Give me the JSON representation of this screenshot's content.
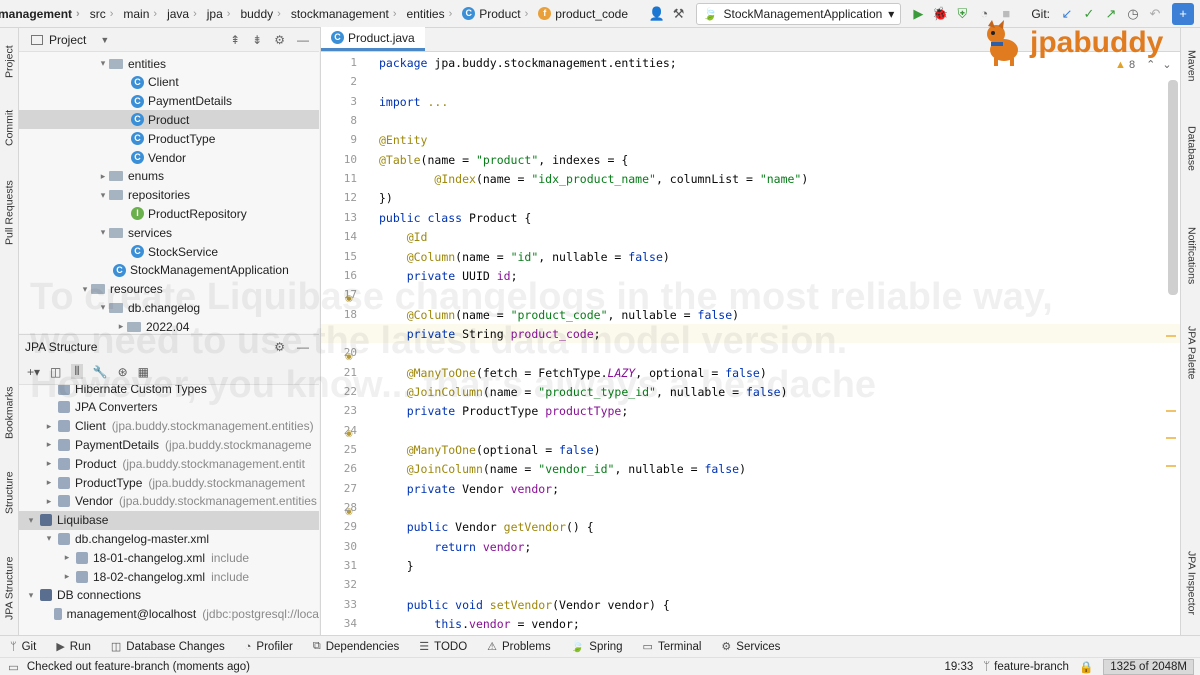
{
  "breadcrumbs": [
    "management",
    "src",
    "main",
    "java",
    "jpa",
    "buddy",
    "stockmanagement",
    "entities",
    "Product",
    "product_code"
  ],
  "run_config": "StockManagementApplication",
  "git_label": "Git:",
  "left_tabs": [
    "Project",
    "Commit",
    "Pull Requests",
    "Bookmarks",
    "Structure",
    "JPA Structure"
  ],
  "right_tabs": [
    "Maven",
    "Database",
    "Notifications",
    "JPA Palette",
    "JPA Inspector"
  ],
  "project_panel": {
    "title": "Project",
    "tree": [
      {
        "label": "entities",
        "kind": "folder",
        "indent": 1,
        "arrow": "▾"
      },
      {
        "label": "Client",
        "kind": "class",
        "indent": 2
      },
      {
        "label": "PaymentDetails",
        "kind": "class",
        "indent": 2
      },
      {
        "label": "Product",
        "kind": "class",
        "indent": 2,
        "selected": true
      },
      {
        "label": "ProductType",
        "kind": "class",
        "indent": 2
      },
      {
        "label": "Vendor",
        "kind": "class",
        "indent": 2
      },
      {
        "label": "enums",
        "kind": "folder",
        "indent": 1,
        "arrow": "▸"
      },
      {
        "label": "repositories",
        "kind": "folder",
        "indent": 1,
        "arrow": "▾"
      },
      {
        "label": "ProductRepository",
        "kind": "interface",
        "indent": 2
      },
      {
        "label": "services",
        "kind": "folder",
        "indent": 1,
        "arrow": "▾"
      },
      {
        "label": "StockService",
        "kind": "class",
        "indent": 2
      },
      {
        "label": "StockManagementApplication",
        "kind": "class",
        "indent": 1
      },
      {
        "label": "resources",
        "kind": "folder",
        "indent": 0,
        "arrow": "▾"
      },
      {
        "label": "db.changelog",
        "kind": "folder",
        "indent": 1,
        "arrow": "▾"
      },
      {
        "label": "2022.04",
        "kind": "folder",
        "indent": 2,
        "arrow": "▸"
      }
    ]
  },
  "jpa_panel": {
    "title": "JPA Structure",
    "tree": [
      {
        "label": "Hibernate Custom Types",
        "extra": "",
        "indent": 1
      },
      {
        "label": "JPA Converters",
        "extra": "",
        "indent": 1
      },
      {
        "label": "Client",
        "extra": "(jpa.buddy.stockmanagement.entities)",
        "indent": 1,
        "arrow": "▸"
      },
      {
        "label": "PaymentDetails",
        "extra": "(jpa.buddy.stockmanageme",
        "indent": 1,
        "arrow": "▸"
      },
      {
        "label": "Product",
        "extra": "(jpa.buddy.stockmanagement.entit",
        "indent": 1,
        "arrow": "▸"
      },
      {
        "label": "ProductType",
        "extra": "(jpa.buddy.stockmanagement",
        "indent": 1,
        "arrow": "▸"
      },
      {
        "label": "Vendor",
        "extra": "(jpa.buddy.stockmanagement.entities",
        "indent": 1,
        "arrow": "▸"
      },
      {
        "label": "Liquibase",
        "extra": "",
        "indent": 0,
        "arrow": "▾",
        "selected": true
      },
      {
        "label": "db.changelog-master.xml",
        "extra": "",
        "indent": 1,
        "arrow": "▾"
      },
      {
        "label": "18-01-changelog.xml",
        "extra": "include",
        "indent": 2,
        "arrow": "▸"
      },
      {
        "label": "18-02-changelog.xml",
        "extra": "include",
        "indent": 2,
        "arrow": "▸"
      },
      {
        "label": "DB connections",
        "extra": "",
        "indent": 0,
        "arrow": "▾"
      },
      {
        "label": "management@localhost",
        "extra": "(jdbc:postgresql://loca",
        "indent": 1
      }
    ]
  },
  "editor": {
    "tab": "Product.java",
    "warnings": "8",
    "lines": [
      {
        "n": "1",
        "code": [
          [
            "kw",
            "package "
          ],
          [
            "",
            "jpa.buddy.stockmanagement.entities;"
          ]
        ]
      },
      {
        "n": "2",
        "code": []
      },
      {
        "n": "3",
        "code": [
          [
            "kw",
            "import "
          ],
          [
            "an",
            "..."
          ]
        ]
      },
      {
        "n": "8",
        "code": []
      },
      {
        "n": "9",
        "code": [
          [
            "an",
            "@Entity"
          ]
        ]
      },
      {
        "n": "10",
        "code": [
          [
            "an",
            "@Table"
          ],
          [
            "",
            "(name = "
          ],
          [
            "st",
            "\"product\""
          ],
          [
            "",
            ", indexes = {"
          ]
        ]
      },
      {
        "n": "11",
        "code": [
          [
            "",
            "        "
          ],
          [
            "an",
            "@Index"
          ],
          [
            "",
            "(name = "
          ],
          [
            "st",
            "\"idx_product_name\""
          ],
          [
            "",
            ", columnList = "
          ],
          [
            "st",
            "\"name\""
          ],
          [
            "",
            ")"
          ]
        ]
      },
      {
        "n": "12",
        "code": [
          [
            "",
            "})"
          ]
        ]
      },
      {
        "n": "13",
        "code": [
          [
            "kw",
            "public class "
          ],
          [
            "",
            "Product {"
          ]
        ]
      },
      {
        "n": "14",
        "code": [
          [
            "",
            "    "
          ],
          [
            "an",
            "@Id"
          ]
        ]
      },
      {
        "n": "15",
        "code": [
          [
            "",
            "    "
          ],
          [
            "an",
            "@Column"
          ],
          [
            "",
            "(name = "
          ],
          [
            "st",
            "\"id\""
          ],
          [
            "",
            ", nullable = "
          ],
          [
            "kw",
            "false"
          ],
          [
            "",
            ")"
          ]
        ]
      },
      {
        "n": "16",
        "code": [
          [
            "",
            "    "
          ],
          [
            "kw",
            "private "
          ],
          [
            "",
            "UUID "
          ],
          [
            "fld",
            "id"
          ],
          [
            "",
            ";"
          ]
        ]
      },
      {
        "n": "17",
        "code": []
      },
      {
        "n": "18",
        "code": [
          [
            "",
            "    "
          ],
          [
            "an",
            "@Column"
          ],
          [
            "",
            "(name = "
          ],
          [
            "st",
            "\"product_code\""
          ],
          [
            "",
            ", nullable = "
          ],
          [
            "kw",
            "false"
          ],
          [
            "",
            ")"
          ]
        ]
      },
      {
        "n": "19",
        "code": [
          [
            "",
            "    "
          ],
          [
            "kw",
            "private "
          ],
          [
            "",
            "String "
          ],
          [
            "fld",
            "product_code"
          ],
          [
            "",
            ";"
          ]
        ]
      },
      {
        "n": "20",
        "code": []
      },
      {
        "n": "21",
        "code": [
          [
            "",
            "    "
          ],
          [
            "an",
            "@ManyToOne"
          ],
          [
            "",
            "(fetch = FetchType."
          ],
          [
            "it",
            "LAZY"
          ],
          [
            "",
            ", optional = "
          ],
          [
            "kw",
            "false"
          ],
          [
            "",
            ")"
          ]
        ]
      },
      {
        "n": "22",
        "code": [
          [
            "",
            "    "
          ],
          [
            "an",
            "@JoinColumn"
          ],
          [
            "",
            "(name = "
          ],
          [
            "st",
            "\"product_type_id\""
          ],
          [
            "",
            ", nullable = "
          ],
          [
            "kw",
            "false"
          ],
          [
            "",
            ")"
          ]
        ]
      },
      {
        "n": "23",
        "code": [
          [
            "",
            "    "
          ],
          [
            "kw",
            "private "
          ],
          [
            "",
            "ProductType "
          ],
          [
            "fld",
            "productType"
          ],
          [
            "",
            ";"
          ]
        ]
      },
      {
        "n": "24",
        "code": []
      },
      {
        "n": "25",
        "code": [
          [
            "",
            "    "
          ],
          [
            "an",
            "@ManyToOne"
          ],
          [
            "",
            "(optional = "
          ],
          [
            "kw",
            "false"
          ],
          [
            "",
            ")"
          ]
        ]
      },
      {
        "n": "26",
        "code": [
          [
            "",
            "    "
          ],
          [
            "an",
            "@JoinColumn"
          ],
          [
            "",
            "(name = "
          ],
          [
            "st",
            "\"vendor_id\""
          ],
          [
            "",
            ", nullable = "
          ],
          [
            "kw",
            "false"
          ],
          [
            "",
            ")"
          ]
        ]
      },
      {
        "n": "27",
        "code": [
          [
            "",
            "    "
          ],
          [
            "kw",
            "private "
          ],
          [
            "",
            "Vendor "
          ],
          [
            "fld",
            "vendor"
          ],
          [
            "",
            ";"
          ]
        ]
      },
      {
        "n": "28",
        "code": []
      },
      {
        "n": "29",
        "code": [
          [
            "",
            "    "
          ],
          [
            "kw",
            "public "
          ],
          [
            "",
            "Vendor "
          ],
          [
            "an",
            "getVendor"
          ],
          [
            "",
            "() {"
          ]
        ]
      },
      {
        "n": "30",
        "code": [
          [
            "",
            "        "
          ],
          [
            "kw",
            "return "
          ],
          [
            "fld",
            "vendor"
          ],
          [
            "",
            ";"
          ]
        ]
      },
      {
        "n": "31",
        "code": [
          [
            "",
            "    }"
          ]
        ]
      },
      {
        "n": "32",
        "code": []
      },
      {
        "n": "33",
        "code": [
          [
            "",
            "    "
          ],
          [
            "kw",
            "public void "
          ],
          [
            "an",
            "setVendor"
          ],
          [
            "",
            "(Vendor vendor) {"
          ]
        ]
      },
      {
        "n": "34",
        "code": [
          [
            "",
            "        "
          ],
          [
            "kw",
            "this"
          ],
          [
            "",
            "."
          ],
          [
            "fld",
            "vendor"
          ],
          [
            "",
            " = vendor;"
          ]
        ]
      }
    ]
  },
  "watermark": [
    "To create Liquibase changelogs in the most reliable way,",
    "we need to use the latest data model version.",
    "However, you know... that's always a headache"
  ],
  "logo_text": "jpabuddy",
  "bottom_tools": [
    "Git",
    "Run",
    "Database Changes",
    "Profiler",
    "Dependencies",
    "TODO",
    "Problems",
    "Spring",
    "Terminal",
    "Services"
  ],
  "status": {
    "message": "Checked out feature-branch (moments ago)",
    "position": "19:33",
    "branch": "feature-branch",
    "memory": "1325 of 2048M"
  }
}
